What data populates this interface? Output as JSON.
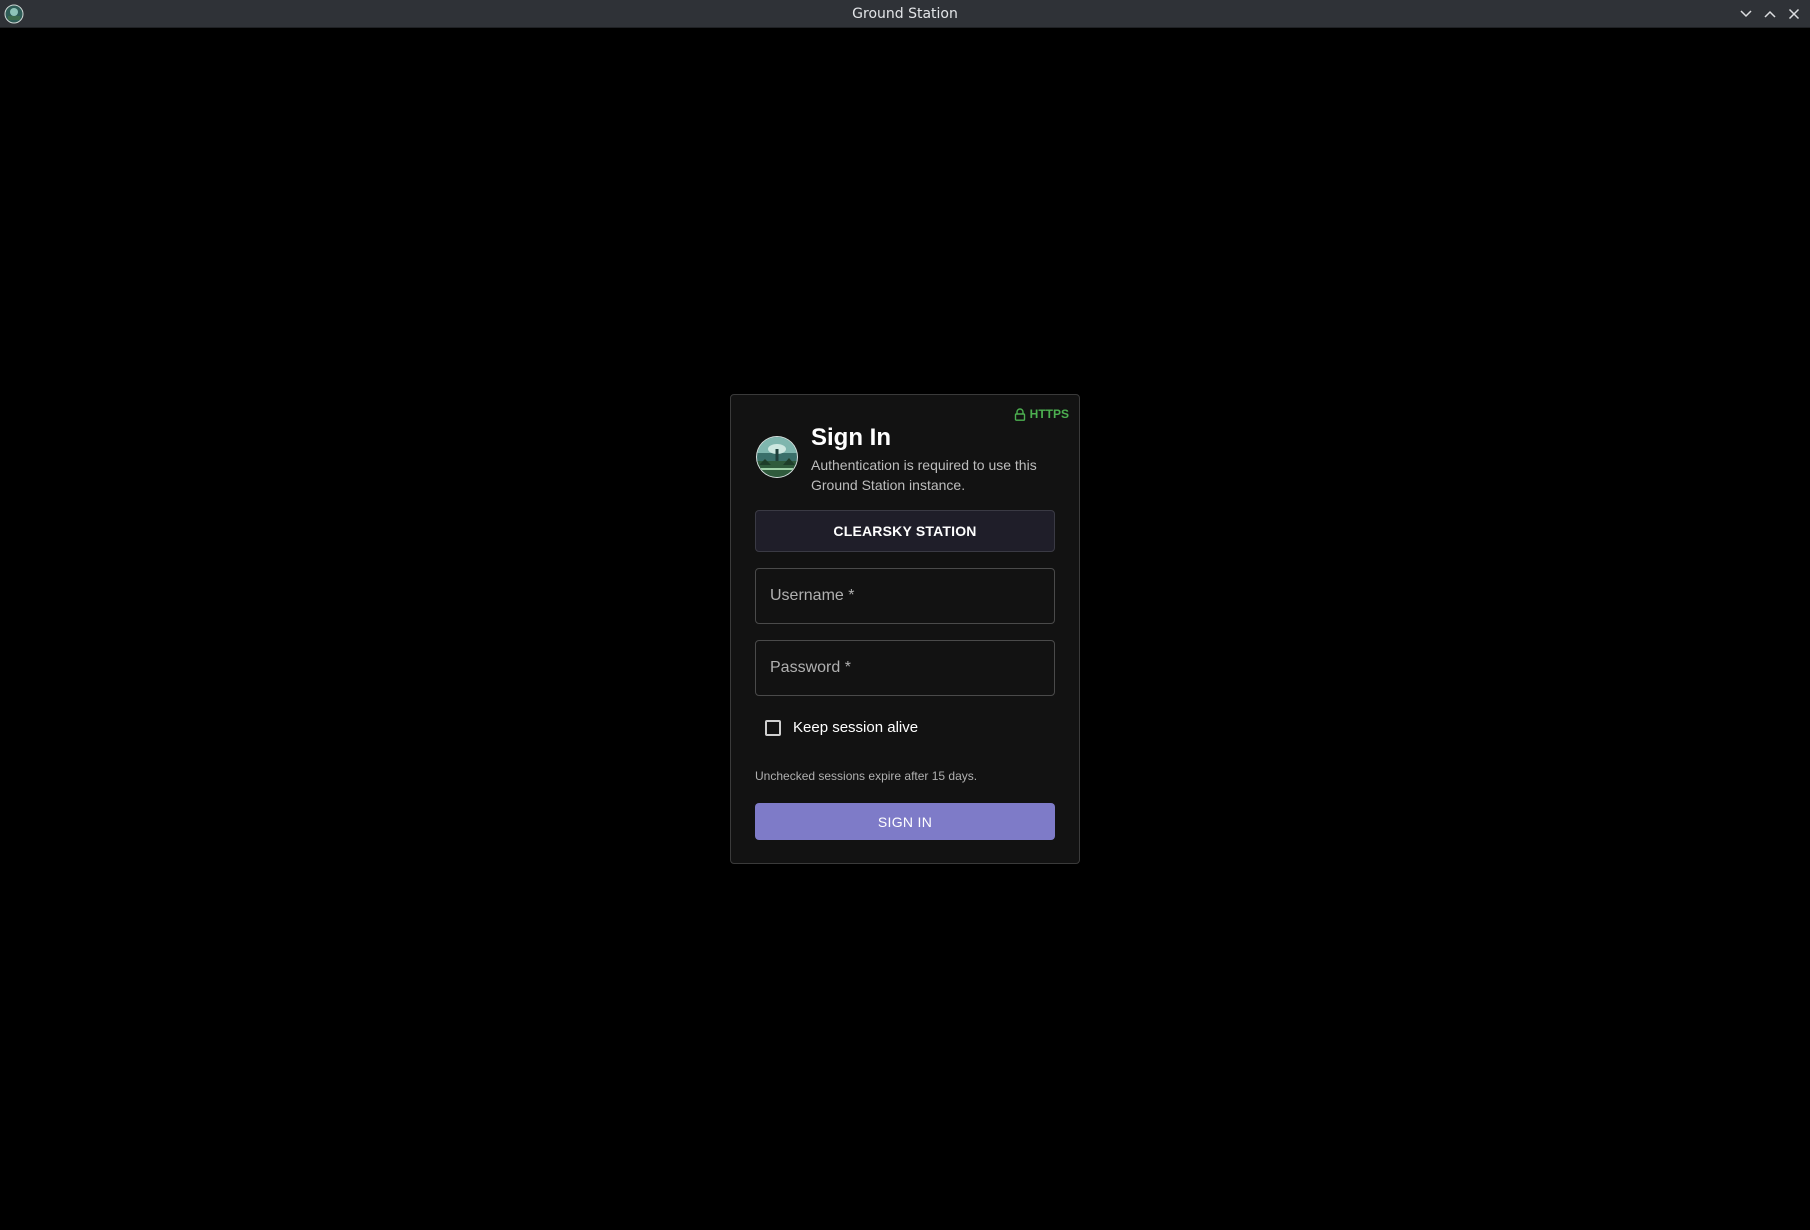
{
  "window": {
    "title": "Ground Station",
    "app_icon": "app-logo-icon",
    "controls": [
      "minimize-icon",
      "maximize-icon",
      "close-icon"
    ]
  },
  "login": {
    "security_badge": "HTTPS",
    "security_icon": "lock-icon",
    "logo_icon": "station-logo-icon",
    "heading": "Sign In",
    "subtitle": "Authentication is required to use this Ground Station instance.",
    "station_name": "CLEARSKY STATION",
    "username_label": "Username *",
    "password_label": "Password *",
    "keep_session_label": "Keep session alive",
    "keep_session_checked": false,
    "expire_note": "Unchecked sessions expire after 15 days.",
    "submit_label": "SIGN IN"
  },
  "colors": {
    "background": "#000000",
    "titlebar": "#2f3237",
    "card": "#121212",
    "accent": "#7e7bc8",
    "secure": "#4caf50",
    "station_chip": "#1f1e29"
  }
}
